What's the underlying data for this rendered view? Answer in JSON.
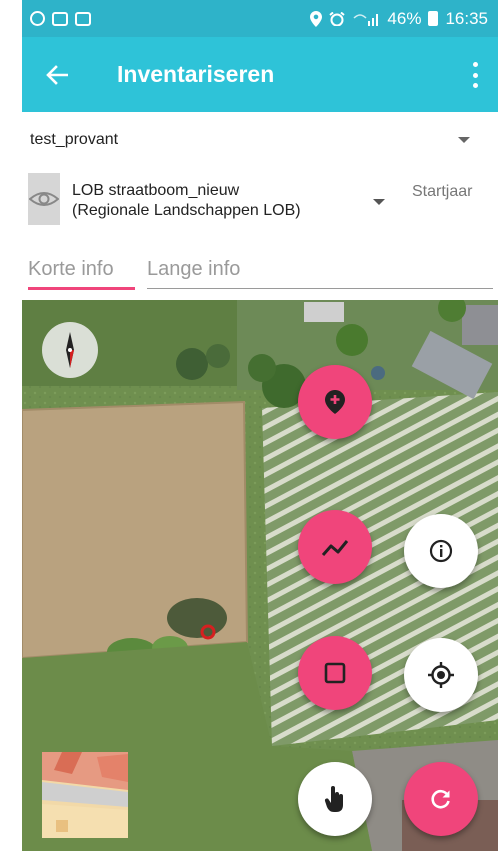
{
  "status_bar": {
    "battery": "46%",
    "time": "16:35"
  },
  "app_bar": {
    "title": "Inventariseren",
    "back_icon": "arrow-left-icon",
    "menu_icon": "more-vertical-icon"
  },
  "project": {
    "selected": "test_provant"
  },
  "layer": {
    "name_line1": "LOB straatboom_nieuw",
    "name_line2": "(Regionale Landschappen LOB)",
    "extra_label": "Startjaar",
    "visibility_icon": "eye-icon"
  },
  "tabs": {
    "short_info": "Korte info",
    "long_info": "Lange info"
  },
  "map": {
    "buttons": [
      {
        "name": "add-point-button",
        "icon": "map-pin-plus-icon"
      },
      {
        "name": "draw-line-button",
        "icon": "polyline-icon"
      },
      {
        "name": "info-button",
        "icon": "info-icon"
      },
      {
        "name": "draw-polygon-button",
        "icon": "square-icon"
      },
      {
        "name": "locate-button",
        "icon": "crosshair-icon"
      },
      {
        "name": "select-button",
        "icon": "hand-pointer-icon"
      },
      {
        "name": "refresh-button",
        "icon": "refresh-icon"
      }
    ],
    "compass_icon": "compass-icon"
  },
  "colors": {
    "status_bar": "#2eb3c9",
    "app_bar": "#2ec3d8",
    "accent": "#f0457b"
  }
}
